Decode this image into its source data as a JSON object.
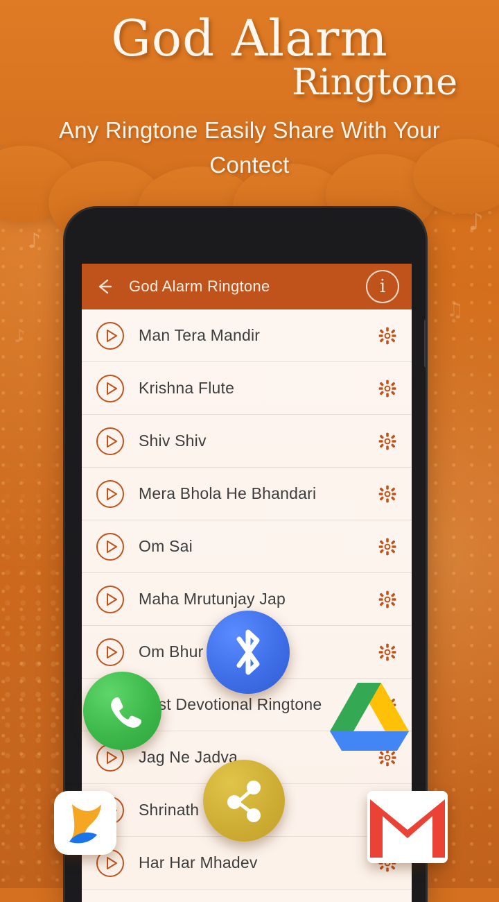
{
  "promo": {
    "title_main": "God Alarm",
    "title_sub": "Ringtone",
    "tagline": "Any Ringtone Easily Share With Your Contect"
  },
  "app": {
    "appbar": {
      "back_icon": "back-arrow-icon",
      "title": "God Alarm Ringtone",
      "info_icon": "info-icon",
      "info_glyph": "i"
    },
    "ringtones": [
      {
        "name": "Man Tera Mandir"
      },
      {
        "name": "Krishna Flute"
      },
      {
        "name": "Shiv Shiv"
      },
      {
        "name": "Mera Bhola He Bhandari"
      },
      {
        "name": "Om Sai"
      },
      {
        "name": "Maha Mrutunjay Jap"
      },
      {
        "name": "Om Bhur"
      },
      {
        "name": "Best Devotional Ringtone"
      },
      {
        "name": "Jag Ne Jadva"
      },
      {
        "name": "Shrinath"
      },
      {
        "name": "Har Har Mhadev"
      }
    ]
  },
  "share_icons": [
    {
      "name": "bluetooth-icon",
      "label": "Bluetooth",
      "color": "#3f6fe8"
    },
    {
      "name": "whatsapp-icon",
      "label": "WhatsApp",
      "color": "#3cb84a"
    },
    {
      "name": "share-icon",
      "label": "Share",
      "color": "#cfae34"
    },
    {
      "name": "google-drive-icon",
      "label": "Google Drive",
      "color": "#f8c93b"
    },
    {
      "name": "gmail-icon",
      "label": "Gmail",
      "color": "#ea4335"
    },
    {
      "name": "xender-icon",
      "label": "Xender",
      "color": "#f7931e"
    }
  ],
  "theme": {
    "background": "#d4701f",
    "appbar": "#c0531b",
    "accent": "#c0531b",
    "list_bg": "#fdf4ee"
  }
}
